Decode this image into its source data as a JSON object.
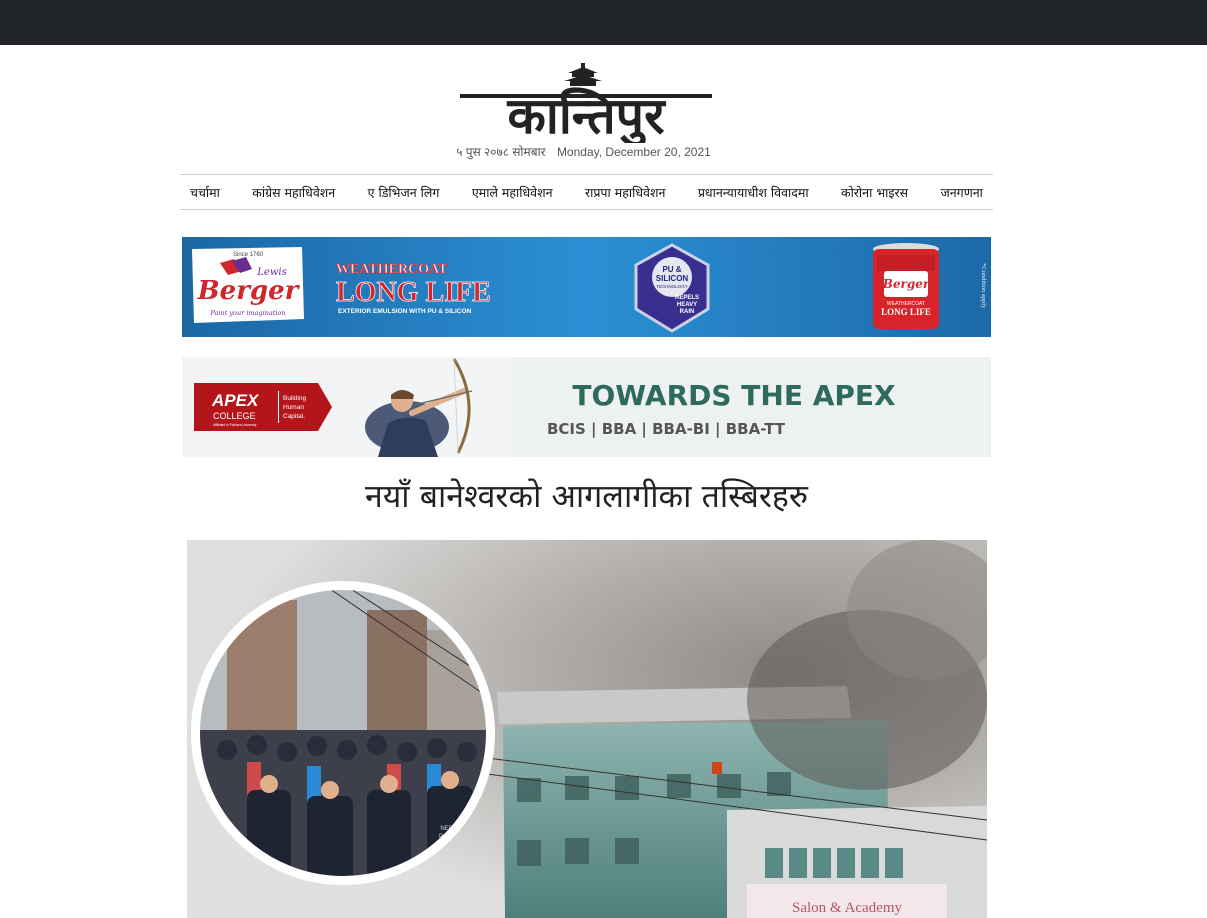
{
  "site": {
    "logo_text": "कान्तिपुर"
  },
  "dates": {
    "nepali": "५ पुस २०७८ सोमबार",
    "english": "Monday, December 20, 2021"
  },
  "nav": [
    "चर्चामा",
    "कांग्रेस महाधिवेशन",
    "ए डिभिजन लिग",
    "एमाले महाधिवेशन",
    "राप्रपा महाधिवेशन",
    "प्रधानन्यायाधीश विवादमा",
    "कोरोना भाइरस",
    "जनगणना"
  ],
  "ads": {
    "berger": {
      "since": "Since 1760",
      "lewis": "Lewis",
      "brand": "Berger",
      "tagline": "Paint your imagination",
      "product_line1": "WEATHERCOAT",
      "product_line2": "LONG LIFE",
      "product_sub": "EXTERIOR EMULSION WITH PU & SILICON",
      "badge_line1": "PU &",
      "badge_line2": "SILICON",
      "badge_line3": "TECHNOLOGY",
      "badge_line4": "REPELS",
      "badge_line5": "HEAVY",
      "badge_line6": "RAIN",
      "can_brand": "Berger",
      "can_line1": "WEATHERCOAT",
      "can_line2": "LONG LIFE",
      "condition": "*Condition apply"
    },
    "apex": {
      "logo_line1": "APEX",
      "logo_line2": "COLLEGE",
      "logo_sub": "Affiliated to Pokhara University",
      "logo_tag1": "Building",
      "logo_tag2": "Human",
      "logo_tag3": "Capital.",
      "headline": "TOWARDS THE APEX",
      "programs": "BCIS | BBA | BBA-BI | BBA-TT"
    }
  },
  "article": {
    "title": "नयाँ बानेश्वरको आगलागीका तस्बिरहरु",
    "inset_texts": [
      "NEPAL",
      "POLICE"
    ],
    "building_sign": "Salon & Academy"
  },
  "colors": {
    "topbar": "#212529",
    "berger_blue": "#1f6fae",
    "berger_red": "#d0262e",
    "apex_red": "#b3151b",
    "apex_green": "#2f6b5a"
  }
}
